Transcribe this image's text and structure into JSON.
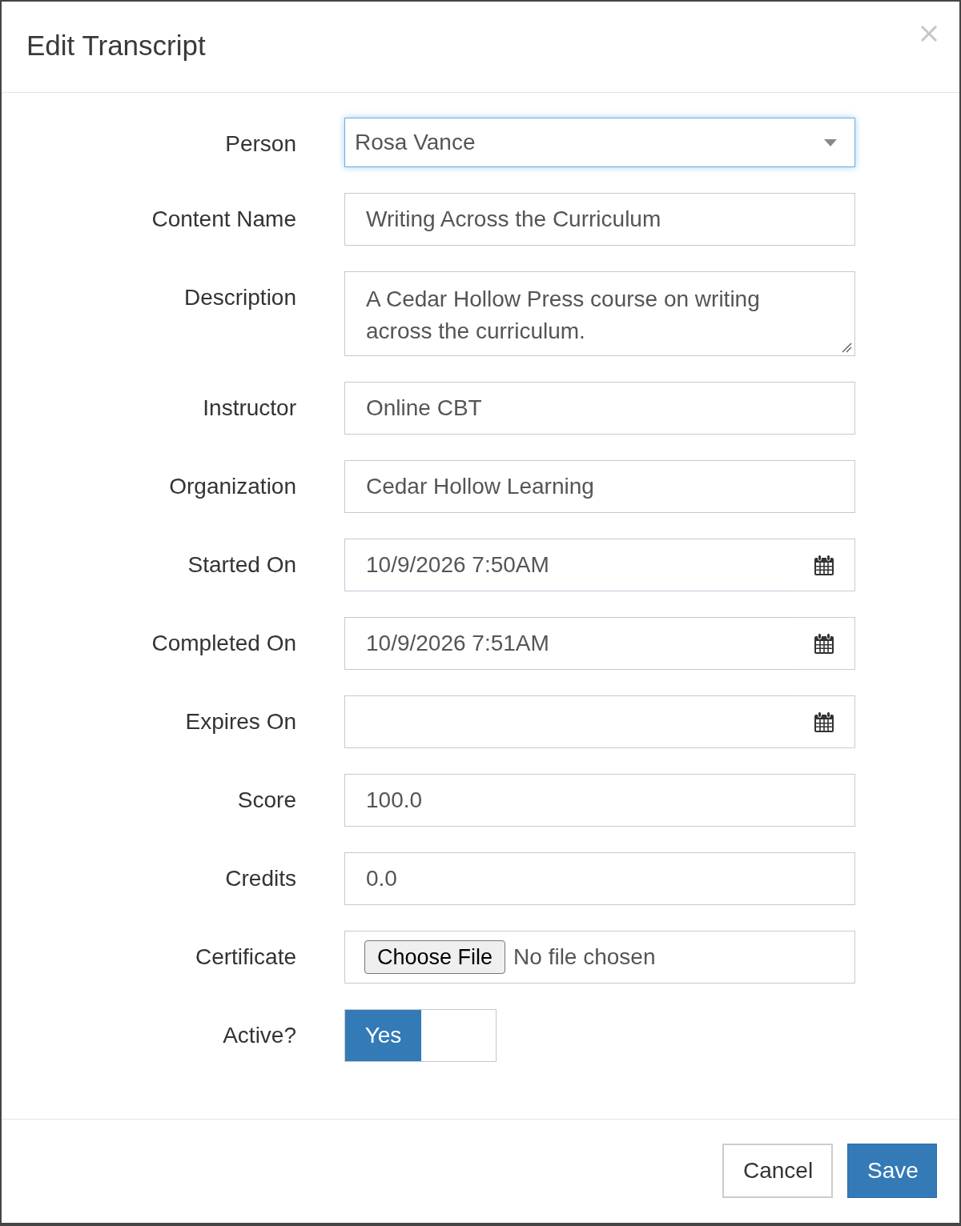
{
  "dialog": {
    "title": "Edit Transcript"
  },
  "fields": [
    {
      "kind": "select",
      "label": "Person",
      "value": "Rosa Vance",
      "focused": true
    },
    {
      "kind": "text",
      "label": "Content Name",
      "value": "Writing Across the Curriculum"
    },
    {
      "kind": "textarea",
      "label": "Description",
      "value": "A Cedar Hollow Press course on writing across the curriculum."
    },
    {
      "kind": "text",
      "label": "Instructor",
      "value": "Online CBT"
    },
    {
      "kind": "text",
      "label": "Organization",
      "value": "Cedar Hollow Learning"
    },
    {
      "kind": "date",
      "label": "Started On",
      "value": "10/9/2026 7:50AM"
    },
    {
      "kind": "date",
      "label": "Completed On",
      "value": "10/9/2026 7:51AM"
    },
    {
      "kind": "date",
      "label": "Expires On"
    },
    {
      "kind": "text",
      "label": "Score",
      "value": "100.0"
    },
    {
      "kind": "text",
      "label": "Credits",
      "value": "0.0"
    },
    {
      "kind": "file",
      "label": "Certificate",
      "button": "Choose File",
      "status": "No file chosen"
    },
    {
      "kind": "toggle",
      "label": "Active?",
      "on": true,
      "on_label": "Yes"
    }
  ],
  "footer": {
    "buttons": [
      {
        "label": "Cancel",
        "kind": "default"
      },
      {
        "label": "Save",
        "kind": "primary"
      }
    ]
  }
}
